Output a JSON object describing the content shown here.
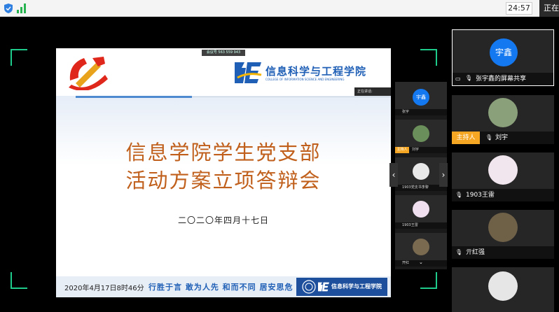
{
  "topbar": {
    "clock": "24:57",
    "right_text": "正在"
  },
  "slide": {
    "college_name": "信息科学与工程学院",
    "college_name_en": "COLLEGE OF INFORMATION SCIENCE AND ENGINEERING",
    "title_line1": "信息学院学生党支部",
    "title_line2": "活动方案立项答辩会",
    "date_cn": "二〇二〇年四月十七日",
    "footer_date": "2020年4月17日8时46分",
    "footer_motto": "行胜于言  敢为人先  和而不同  居安思危",
    "footer_logo_text": "信息科学与工程学院"
  },
  "meeting_badge": "会议号 563 559 943",
  "speaking_label": "正在讲话:",
  "mini_panel": {
    "items": [
      {
        "label": "张宇",
        "avatar": "宇鑫"
      },
      {
        "label": "刘宇",
        "host": "主持人"
      },
      {
        "label": "1903党支书李黎"
      },
      {
        "label": "1903王雷"
      },
      {
        "label": "开红"
      }
    ]
  },
  "participants": {
    "active": {
      "avatar_text": "宇鑫",
      "label": "张宇鑫的屏幕共享"
    },
    "tiles": [
      {
        "name": "刘宇",
        "host_label": "主持人"
      },
      {
        "name": "1903王雷"
      },
      {
        "name": "亓红强"
      }
    ]
  },
  "colors": {
    "accent": "#1ecb8a",
    "avatar_blue": "#1478f0",
    "host": "#f5a623",
    "title": "#c0601c"
  }
}
